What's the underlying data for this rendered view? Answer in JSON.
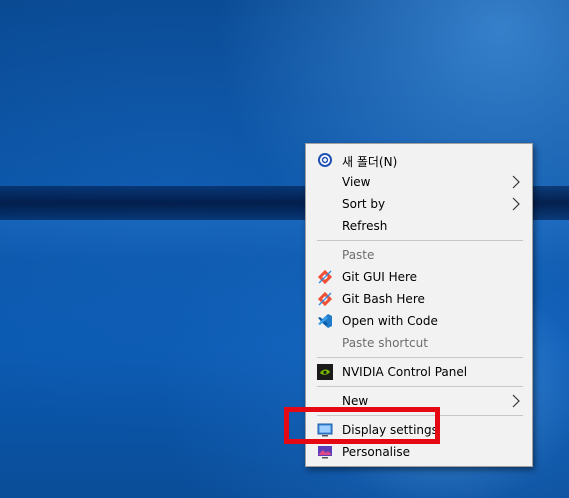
{
  "menu": {
    "items": [
      {
        "label": "새 폴더(N)",
        "icon": "new-folder-icon"
      },
      {
        "label": "View",
        "submenu": true
      },
      {
        "label": "Sort by",
        "submenu": true
      },
      {
        "label": "Refresh"
      },
      {
        "label": "Paste",
        "disabled": true
      },
      {
        "label": "Git GUI Here",
        "icon": "git-icon"
      },
      {
        "label": "Git Bash Here",
        "icon": "git-icon"
      },
      {
        "label": "Open with Code",
        "icon": "vscode-icon"
      },
      {
        "label": "Paste shortcut",
        "disabled": true
      },
      {
        "label": "NVIDIA Control Panel",
        "icon": "nvidia-icon"
      },
      {
        "label": "New",
        "submenu": true
      },
      {
        "label": "Display settings",
        "icon": "display-icon"
      },
      {
        "label": "Personalise",
        "icon": "personalise-icon"
      }
    ]
  },
  "colors": {
    "highlight_box": "#e50914",
    "menu_background": "#f2f2f2",
    "disabled_text": "#6d6d6d"
  }
}
